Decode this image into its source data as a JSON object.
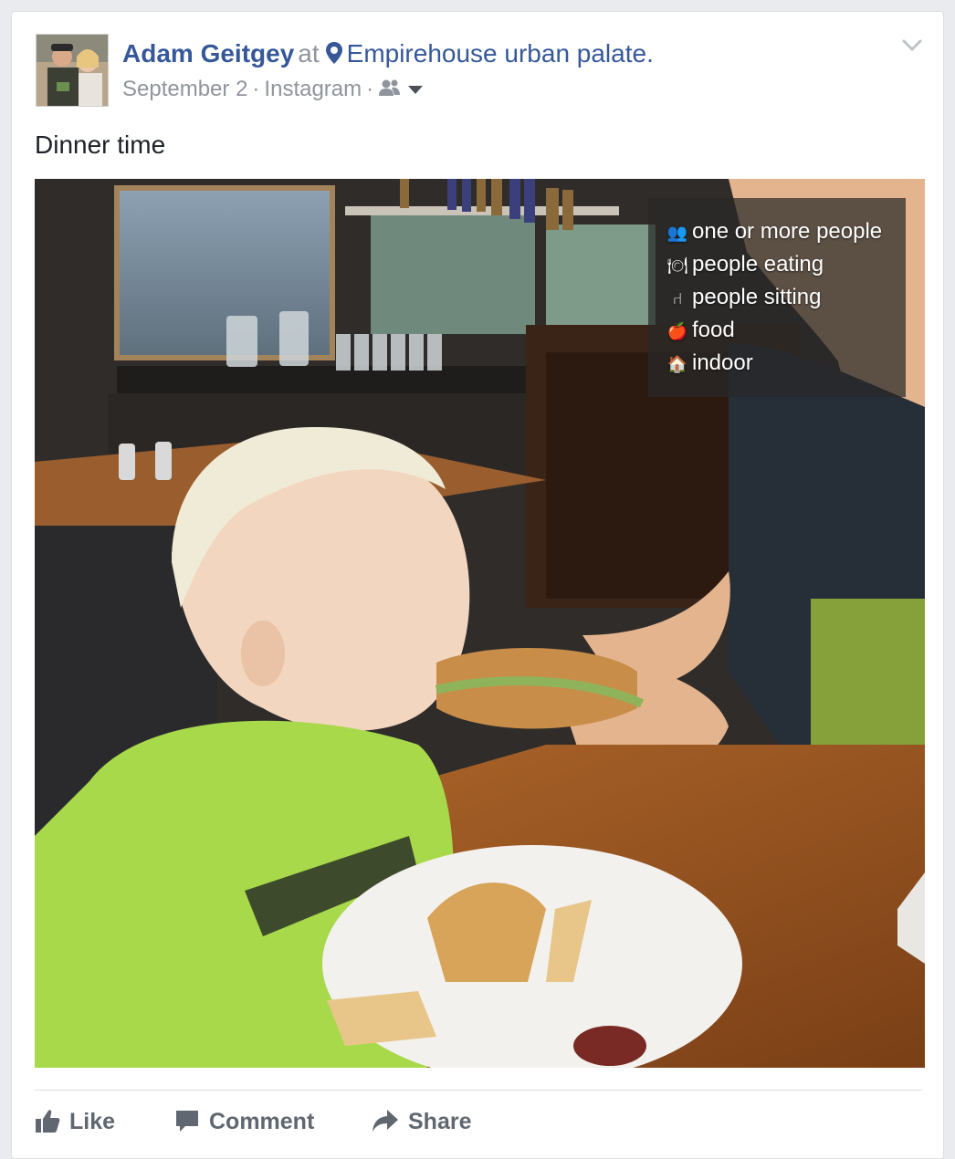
{
  "post": {
    "author": "Adam Geitgey",
    "at_word": "at",
    "place": "Empirehouse urban palate.",
    "date": "September 2",
    "dot": "·",
    "source": "Instagram",
    "text": "Dinner time"
  },
  "icons": {
    "location": "location-pin-icon",
    "audience": "friends-icon",
    "dropdown": "caret-down-icon",
    "menu": "chevron-down-icon"
  },
  "photo": {
    "alt_tags": [
      {
        "icon": "people-icon",
        "glyph": "👥",
        "label": "one or more people"
      },
      {
        "icon": "plate-icon",
        "glyph": "🍽",
        "label": "people eating"
      },
      {
        "icon": "chair-icon",
        "glyph": "⑁",
        "label": "people sitting"
      },
      {
        "icon": "apple-icon",
        "glyph": "🍎",
        "label": "food"
      },
      {
        "icon": "house-icon",
        "glyph": "🏠",
        "label": "indoor"
      }
    ]
  },
  "actions": {
    "like": "Like",
    "comment": "Comment",
    "share": "Share"
  },
  "colors": {
    "link_blue": "#365899",
    "meta_gray": "#90949c",
    "action_gray": "#606770"
  }
}
